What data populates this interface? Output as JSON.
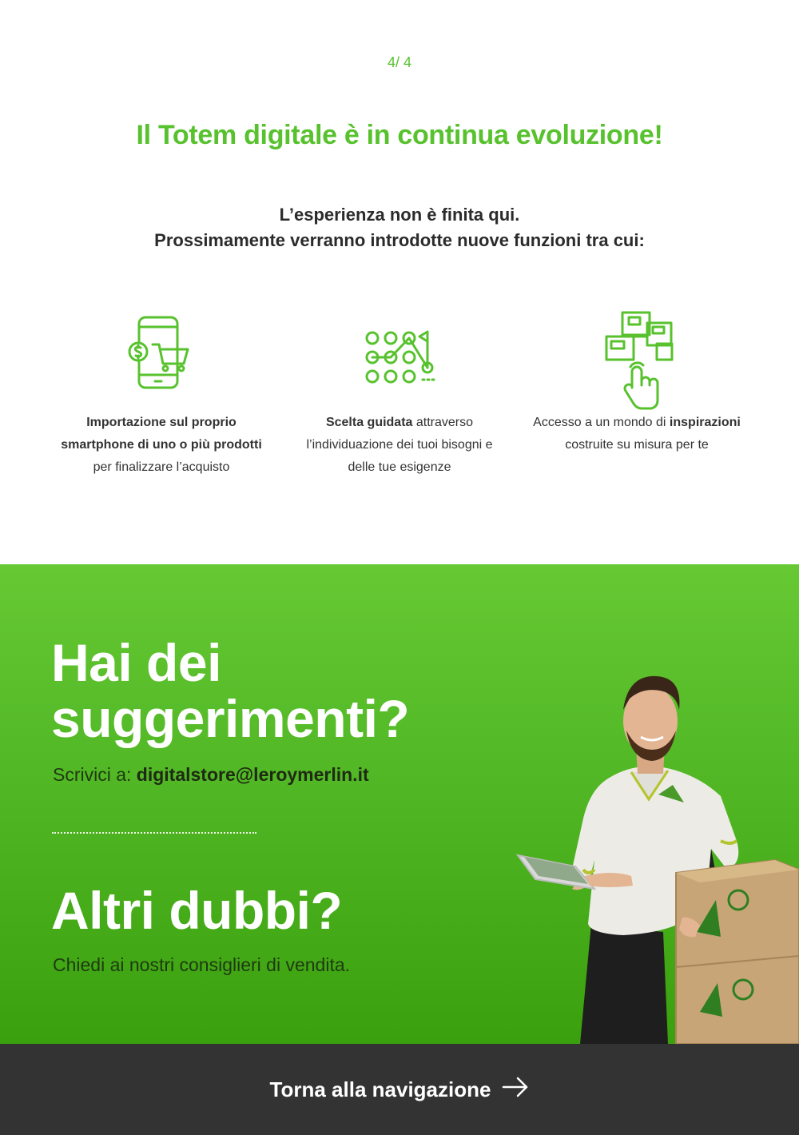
{
  "pager": "4/ 4",
  "headline": "Il Totem digitale è in continua evoluzione!",
  "intro": {
    "line1": "L’esperienza non è finita qui.",
    "line2": "Prossimamente verranno introdotte nuove funzioni tra cui:"
  },
  "features": [
    {
      "icon": "phone-cart-icon",
      "bold": "Importazione sul proprio smartphone di uno o più prodotti",
      "rest": " per finalizzare l’acquisto"
    },
    {
      "icon": "guided-path-icon",
      "bold": "Scelta guidata",
      "rest": " attraverso l’individuazione dei tuoi bisogni e delle tue esigenze"
    },
    {
      "icon": "boxes-touch-icon",
      "pre": "Accesso a un mondo di ",
      "bold": "inspirazioni",
      "rest": " costruite su misura per te"
    }
  ],
  "suggest": {
    "title_line1": "Hai dei",
    "title_line2": "suggerimenti?",
    "prefix": "Scrivici a: ",
    "email": "digitalstore@leroymerlin.it"
  },
  "doubts": {
    "title": "Altri dubbi?",
    "text": "Chiedi ai nostri consiglieri di vendita."
  },
  "footer": {
    "back_label": "Torna alla navigazione"
  },
  "colors": {
    "brand_green": "#58c22e",
    "footer_bg": "#333333"
  }
}
